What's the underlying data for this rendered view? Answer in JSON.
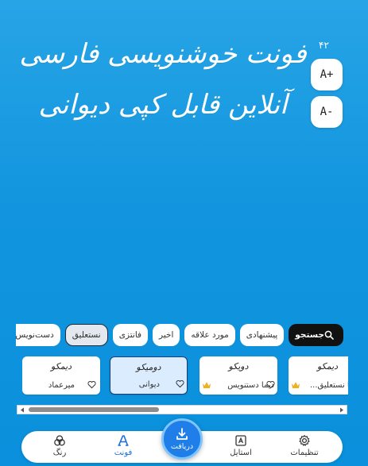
{
  "preview": {
    "text": "فونت خوشنویسی فارسی آنلاین قابل کپی دیوانی",
    "font_size": "۴۲",
    "increase_label": "A+",
    "decrease_label": "A-"
  },
  "chips": {
    "search": "جستجو",
    "items": [
      "پیشنهادی",
      "مورد علاقه",
      "اخیر",
      "فانتزی",
      "نستعلیق",
      "دست‌نویس"
    ],
    "active": "نستعلیق"
  },
  "cards": [
    {
      "sample": "دیمکو",
      "name": "دیما نستعلیق...",
      "premium": true
    },
    {
      "sample": "دویکو",
      "name": "دیما دستنویس",
      "premium": true
    },
    {
      "sample": "دومیکو",
      "name": "دیوانی",
      "premium": false
    },
    {
      "sample": "دیمکو",
      "name": "میرعماد",
      "premium": false
    }
  ],
  "nav": {
    "settings": "تنظیمات",
    "style": "استایل",
    "download": "دریافت",
    "font": "فونت",
    "color": "رنگ"
  },
  "colors": {
    "background": "#1295de",
    "accent": "#1a6fd8",
    "crown": "#f2b01e"
  }
}
